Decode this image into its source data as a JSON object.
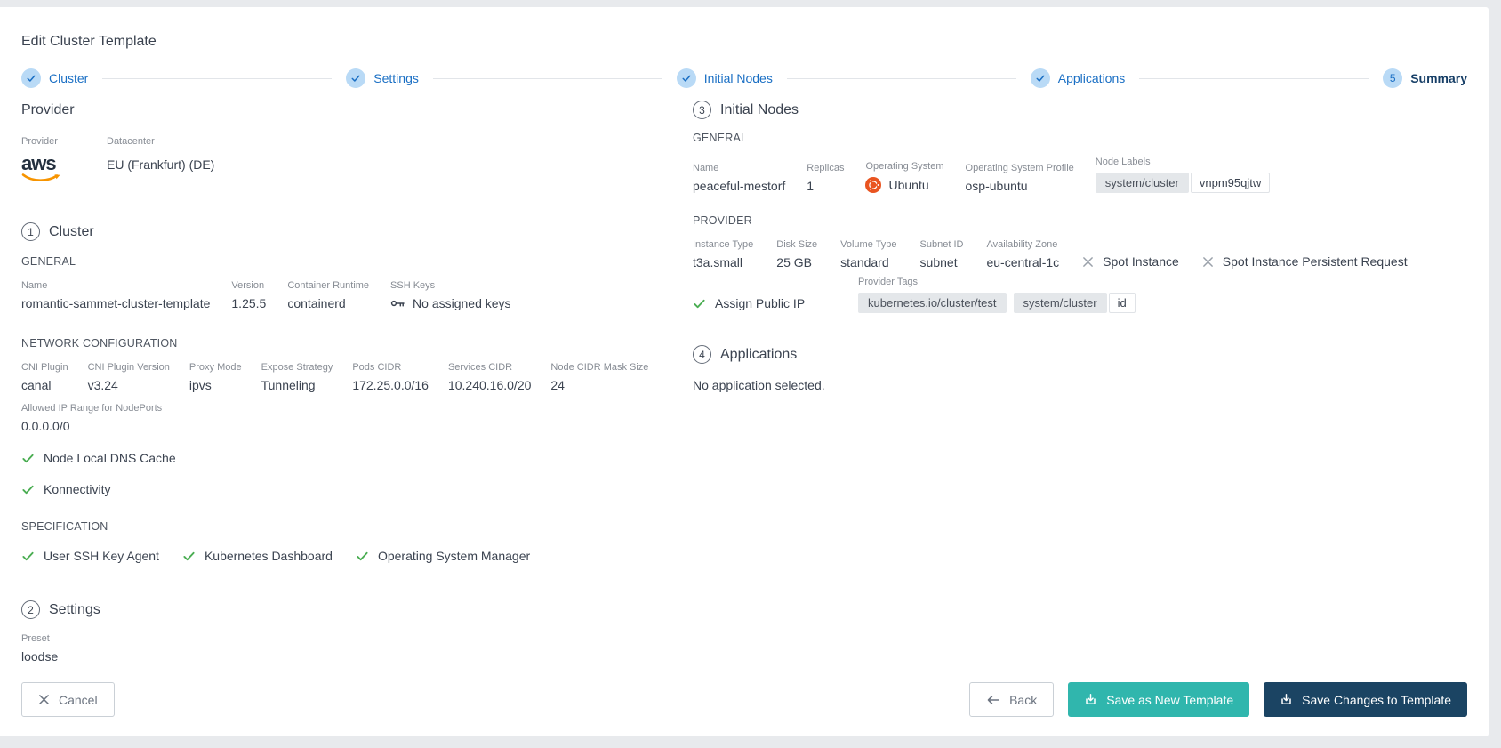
{
  "page": {
    "title": "Edit Cluster Template"
  },
  "stepper": {
    "steps": [
      {
        "label": "Cluster",
        "state": "done"
      },
      {
        "label": "Settings",
        "state": "done"
      },
      {
        "label": "Initial Nodes",
        "state": "done"
      },
      {
        "label": "Applications",
        "state": "done"
      },
      {
        "label": "Summary",
        "state": "active",
        "number": "5"
      }
    ]
  },
  "provider": {
    "heading": "Provider",
    "fields": [
      {
        "label": "Provider",
        "value": "aws"
      },
      {
        "label": "Datacenter",
        "value": "EU (Frankfurt) (DE)"
      }
    ]
  },
  "cluster": {
    "number": "1",
    "heading": "Cluster",
    "general": {
      "heading": "GENERAL",
      "fields": [
        {
          "label": "Name",
          "value": "romantic-sammet-cluster-template"
        },
        {
          "label": "Version",
          "value": "1.25.5"
        },
        {
          "label": "Container Runtime",
          "value": "containerd"
        },
        {
          "label": "SSH Keys",
          "value": "No assigned keys"
        }
      ]
    },
    "network": {
      "heading": "NETWORK CONFIGURATION",
      "fields": [
        {
          "label": "CNI Plugin",
          "value": "canal"
        },
        {
          "label": "CNI Plugin Version",
          "value": "v3.24"
        },
        {
          "label": "Proxy Mode",
          "value": "ipvs"
        },
        {
          "label": "Expose Strategy",
          "value": "Tunneling"
        },
        {
          "label": "Pods CIDR",
          "value": "172.25.0.0/16"
        },
        {
          "label": "Services CIDR",
          "value": "10.240.16.0/20"
        },
        {
          "label": "Node CIDR Mask Size",
          "value": "24"
        },
        {
          "label": "Allowed IP Range for NodePorts",
          "value": "0.0.0.0/0"
        }
      ],
      "enabled": [
        "Node Local DNS Cache",
        "Konnectivity"
      ]
    },
    "specification": {
      "heading": "SPECIFICATION",
      "enabled": [
        "User SSH Key Agent",
        "Kubernetes Dashboard",
        "Operating System Manager"
      ]
    }
  },
  "settings": {
    "number": "2",
    "heading": "Settings",
    "fields": [
      {
        "label": "Preset",
        "value": "loodse"
      }
    ]
  },
  "initial_nodes": {
    "number": "3",
    "heading": "Initial Nodes",
    "general": {
      "heading": "GENERAL",
      "fields": [
        {
          "label": "Name",
          "value": "peaceful-mestorf"
        },
        {
          "label": "Replicas",
          "value": "1"
        },
        {
          "label": "Operating System",
          "value": "Ubuntu"
        },
        {
          "label": "Operating System Profile",
          "value": "osp-ubuntu"
        }
      ],
      "node_labels": {
        "label": "Node Labels",
        "chips": [
          {
            "key": "system/cluster",
            "value": "vnpm95qjtw"
          }
        ]
      }
    },
    "provider": {
      "heading": "PROVIDER",
      "fields": [
        {
          "label": "Instance Type",
          "value": "t3a.small"
        },
        {
          "label": "Disk Size",
          "value": "25 GB"
        },
        {
          "label": "Volume Type",
          "value": "standard"
        },
        {
          "label": "Subnet ID",
          "value": "subnet"
        },
        {
          "label": "Availability Zone",
          "value": "eu-central-1c"
        }
      ],
      "disabled": [
        "Spot Instance",
        "Spot Instance Persistent Request"
      ],
      "enabled": [
        "Assign Public IP"
      ],
      "tags": {
        "label": "Provider Tags",
        "chips": [
          {
            "key": "kubernetes.io/cluster/test",
            "value": ""
          },
          {
            "key": "system/cluster",
            "value": "id"
          }
        ]
      }
    }
  },
  "applications": {
    "number": "4",
    "heading": "Applications",
    "empty_text": "No application selected."
  },
  "footer": {
    "cancel": "Cancel",
    "back": "Back",
    "save_new": "Save as New Template",
    "save_changes": "Save Changes to Template"
  },
  "colors": {
    "stepper_blue": "#1a6fc4",
    "active_step_text": "#163e66",
    "green_check": "#4aad52",
    "gray_cross": "#9aa1aa",
    "teal_button": "#30b6ad",
    "navy_button": "#1b4463",
    "aws_orange": "#f79400",
    "ubuntu_orange": "#e95420"
  }
}
